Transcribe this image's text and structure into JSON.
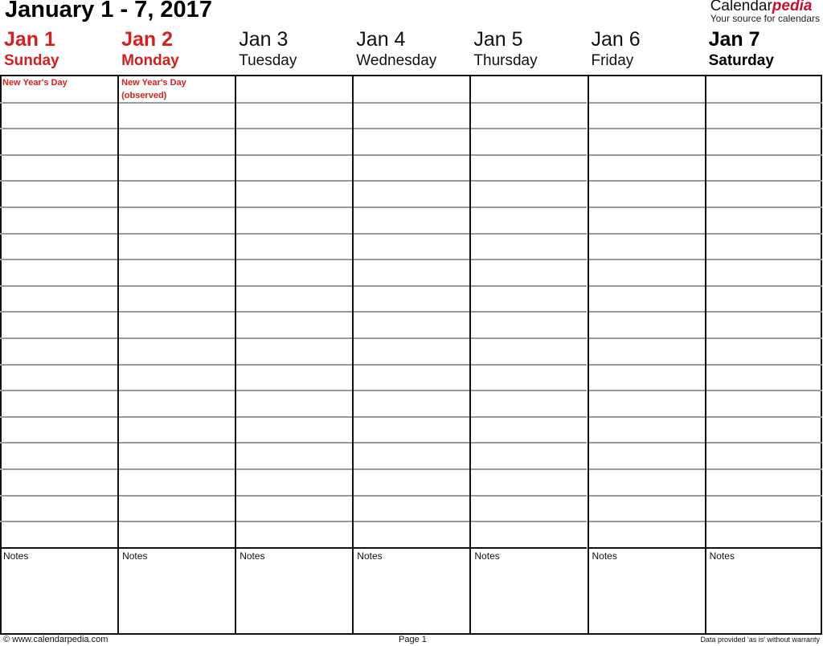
{
  "title": "January 1 - 7, 2017",
  "brand": {
    "name_plain": "Calendar",
    "name_accent": "pedia",
    "tagline": "Your source for calendars",
    "accent_color": "#c8102e"
  },
  "days": [
    {
      "date": "Jan 1",
      "weekday": "Sunday",
      "style": "red",
      "holiday": [
        "New Year's Day"
      ]
    },
    {
      "date": "Jan 2",
      "weekday": "Monday",
      "style": "red",
      "holiday": [
        "New Year's Day",
        "(observed)"
      ]
    },
    {
      "date": "Jan 3",
      "weekday": "Tuesday",
      "style": "normal",
      "holiday": []
    },
    {
      "date": "Jan 4",
      "weekday": "Wednesday",
      "style": "normal",
      "holiday": []
    },
    {
      "date": "Jan 5",
      "weekday": "Thursday",
      "style": "normal",
      "holiday": []
    },
    {
      "date": "Jan 6",
      "weekday": "Friday",
      "style": "normal",
      "holiday": []
    },
    {
      "date": "Jan 7",
      "weekday": "Saturday",
      "style": "bold",
      "holiday": []
    }
  ],
  "notes_label": "Notes",
  "rows_per_day": 18,
  "footer": {
    "left": "© www.calendarpedia.com",
    "center": "Page 1",
    "right": "Data provided 'as is' without warranty"
  },
  "colors": {
    "holiday": "#d42020",
    "grid": "#111111",
    "row_line": "#9a9a9a"
  }
}
